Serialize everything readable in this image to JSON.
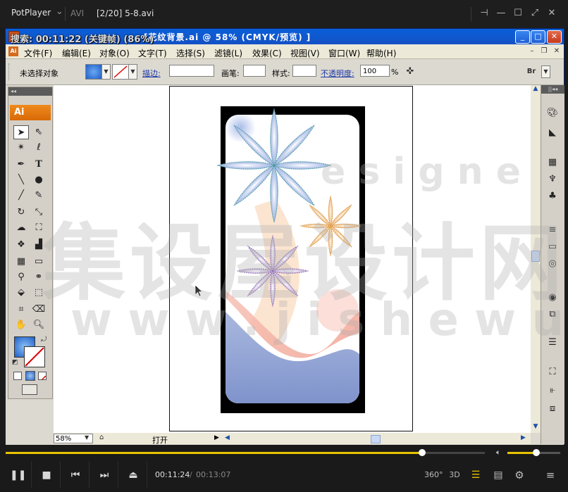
{
  "player": {
    "app_name": "PotPlayer",
    "format": "AVI",
    "file_title": "[2/20] 5-8.avi",
    "osd_text": "搜索: 00:11:22 (关键帧) (86%)",
    "window_buttons": {
      "pin": "pin-icon",
      "minimize": "minimize-icon",
      "maximize": "maximize-icon",
      "fullscreen": "fullscreen-icon",
      "close": "close-icon"
    },
    "time_current": "00:11:24",
    "time_separator": "/",
    "time_total": "00:13:07",
    "progress": 0.869,
    "volume": 0.55,
    "controls": {
      "three_sixty": "360°",
      "three_d": "3D"
    },
    "accent_color": "#e8c300"
  },
  "illustrator": {
    "window_title": "Adobe Illustrator - [花纹背景.ai @ 58% (CMYK/预览)]",
    "window_title_visible": "[花纹背景.ai @ 58% (CMYK/预览) ]",
    "menu": [
      "文件(F)",
      "编辑(E)",
      "对象(O)",
      "文字(T)",
      "选择(S)",
      "滤镜(L)",
      "效果(C)",
      "视图(V)",
      "窗口(W)",
      "帮助(H)"
    ],
    "control_bar": {
      "selection_label": "未选择对象",
      "stroke_label": "描边:",
      "brush_label": "画笔:",
      "style_label": "样式:",
      "opacity_label": "不透明度:",
      "opacity_value": "100",
      "opacity_unit": "%"
    },
    "tools_logo": "Ai",
    "zoom_value": "58%",
    "status_text": "打开",
    "title_bar_color": "#0a5fd8"
  },
  "watermark": {
    "line1": "集设屋设计网",
    "line2": "w w w . j i s h e w u . c o m",
    "line3": "e s i g n e"
  }
}
